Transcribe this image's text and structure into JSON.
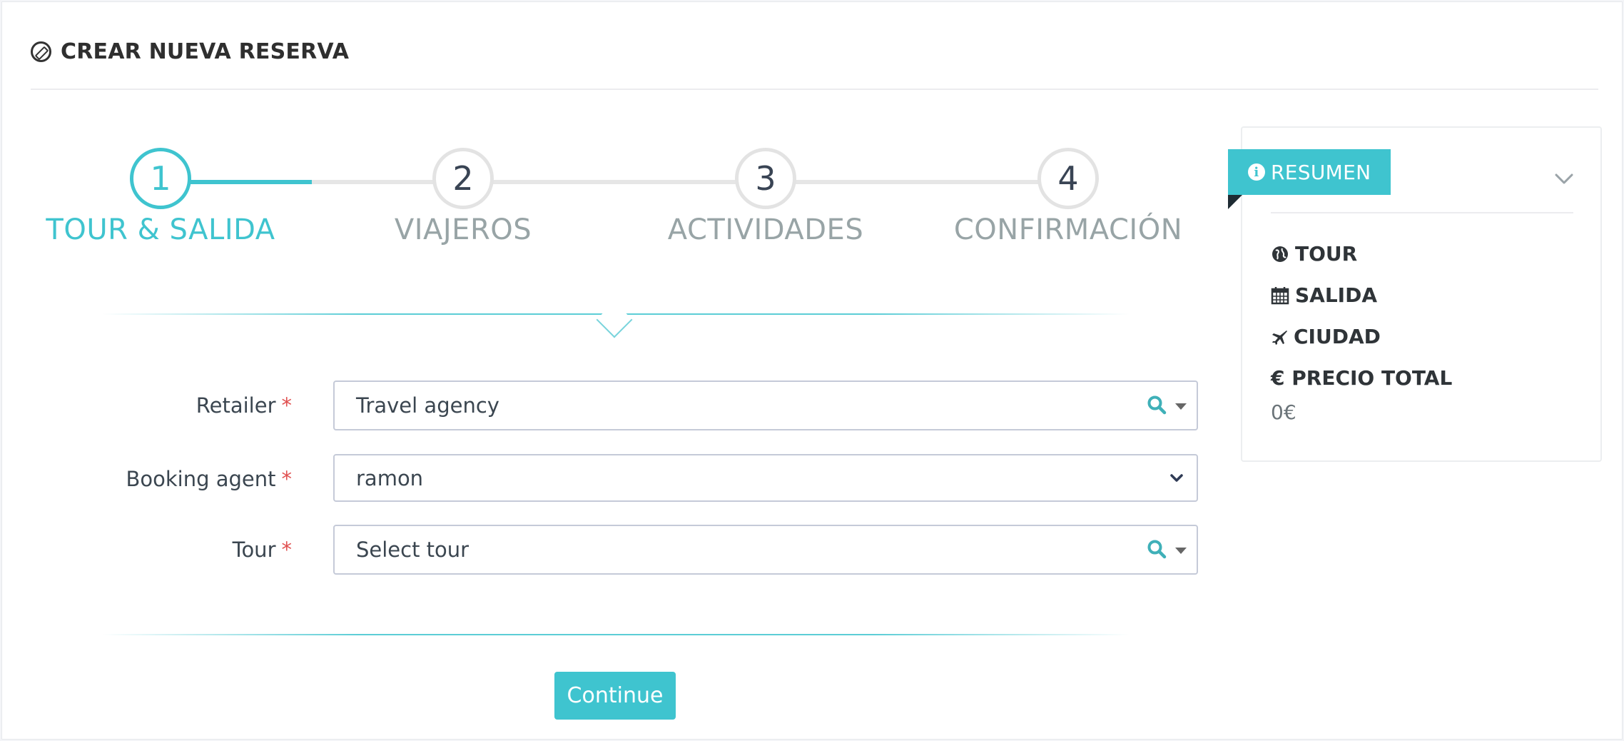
{
  "header": {
    "title": "CREAR NUEVA RESERVA",
    "icon": "compass-icon"
  },
  "stepper": {
    "active_step": 1,
    "steps": [
      {
        "number": "1",
        "label": "TOUR & SALIDA"
      },
      {
        "number": "2",
        "label": "VIAJEROS"
      },
      {
        "number": "3",
        "label": "ACTIVIDADES"
      },
      {
        "number": "4",
        "label": "CONFIRMACIÓN"
      }
    ]
  },
  "form": {
    "retailer": {
      "label": "Retailer",
      "required_mark": "*",
      "value": "Travel agency"
    },
    "booking_agent": {
      "label": "Booking agent",
      "required_mark": "*",
      "value": "ramon"
    },
    "tour": {
      "label": "Tour",
      "required_mark": "*",
      "placeholder": "Select tour"
    }
  },
  "actions": {
    "continue_label": "Continue"
  },
  "summary": {
    "title": "RESUMEN",
    "items": [
      {
        "icon": "globe-icon",
        "label": "TOUR"
      },
      {
        "icon": "calendar-icon",
        "label": "SALIDA"
      },
      {
        "icon": "plane-icon",
        "label": "CIUDAD"
      },
      {
        "icon": "euro-icon",
        "label": "€ PRECIO TOTAL"
      }
    ],
    "total": "0€"
  },
  "colors": {
    "accent": "#3fc4cf",
    "required": "#e05050",
    "text": "#3b4650",
    "muted": "#98a4a6"
  }
}
